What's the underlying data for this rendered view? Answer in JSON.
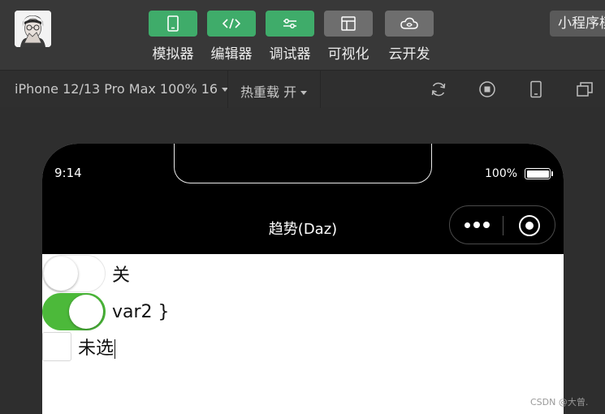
{
  "toolbar": {
    "tools": [
      {
        "label": "模拟器",
        "icon": "phone-icon",
        "style": "green"
      },
      {
        "label": "编辑器",
        "icon": "code-icon",
        "style": "green"
      },
      {
        "label": "调试器",
        "icon": "sliders-icon",
        "style": "green"
      },
      {
        "label": "可视化",
        "icon": "layout-icon",
        "style": "gray"
      },
      {
        "label": "云开发",
        "icon": "cloud-icon",
        "style": "gray"
      }
    ],
    "mini_program_label": "小程序模式"
  },
  "subbar": {
    "device": "iPhone 12/13 Pro Max 100% 16",
    "hot_reload": "热重载 开",
    "icons": [
      "refresh-icon",
      "stop-icon",
      "device-icon",
      "window-icon"
    ]
  },
  "phone": {
    "time": "9:14",
    "battery": "100%",
    "battery_level": 1.0,
    "nav_title": "趋势(Daz)"
  },
  "content": {
    "switch1": {
      "checked": false,
      "label": "关"
    },
    "switch2": {
      "checked": true,
      "label": "var2 }"
    },
    "checkbox": {
      "checked": false,
      "label": "未选"
    }
  },
  "colors": {
    "accent_green": "#3fac6a",
    "switch_on": "#4cb93a"
  },
  "watermark": "CSDN @大曾."
}
